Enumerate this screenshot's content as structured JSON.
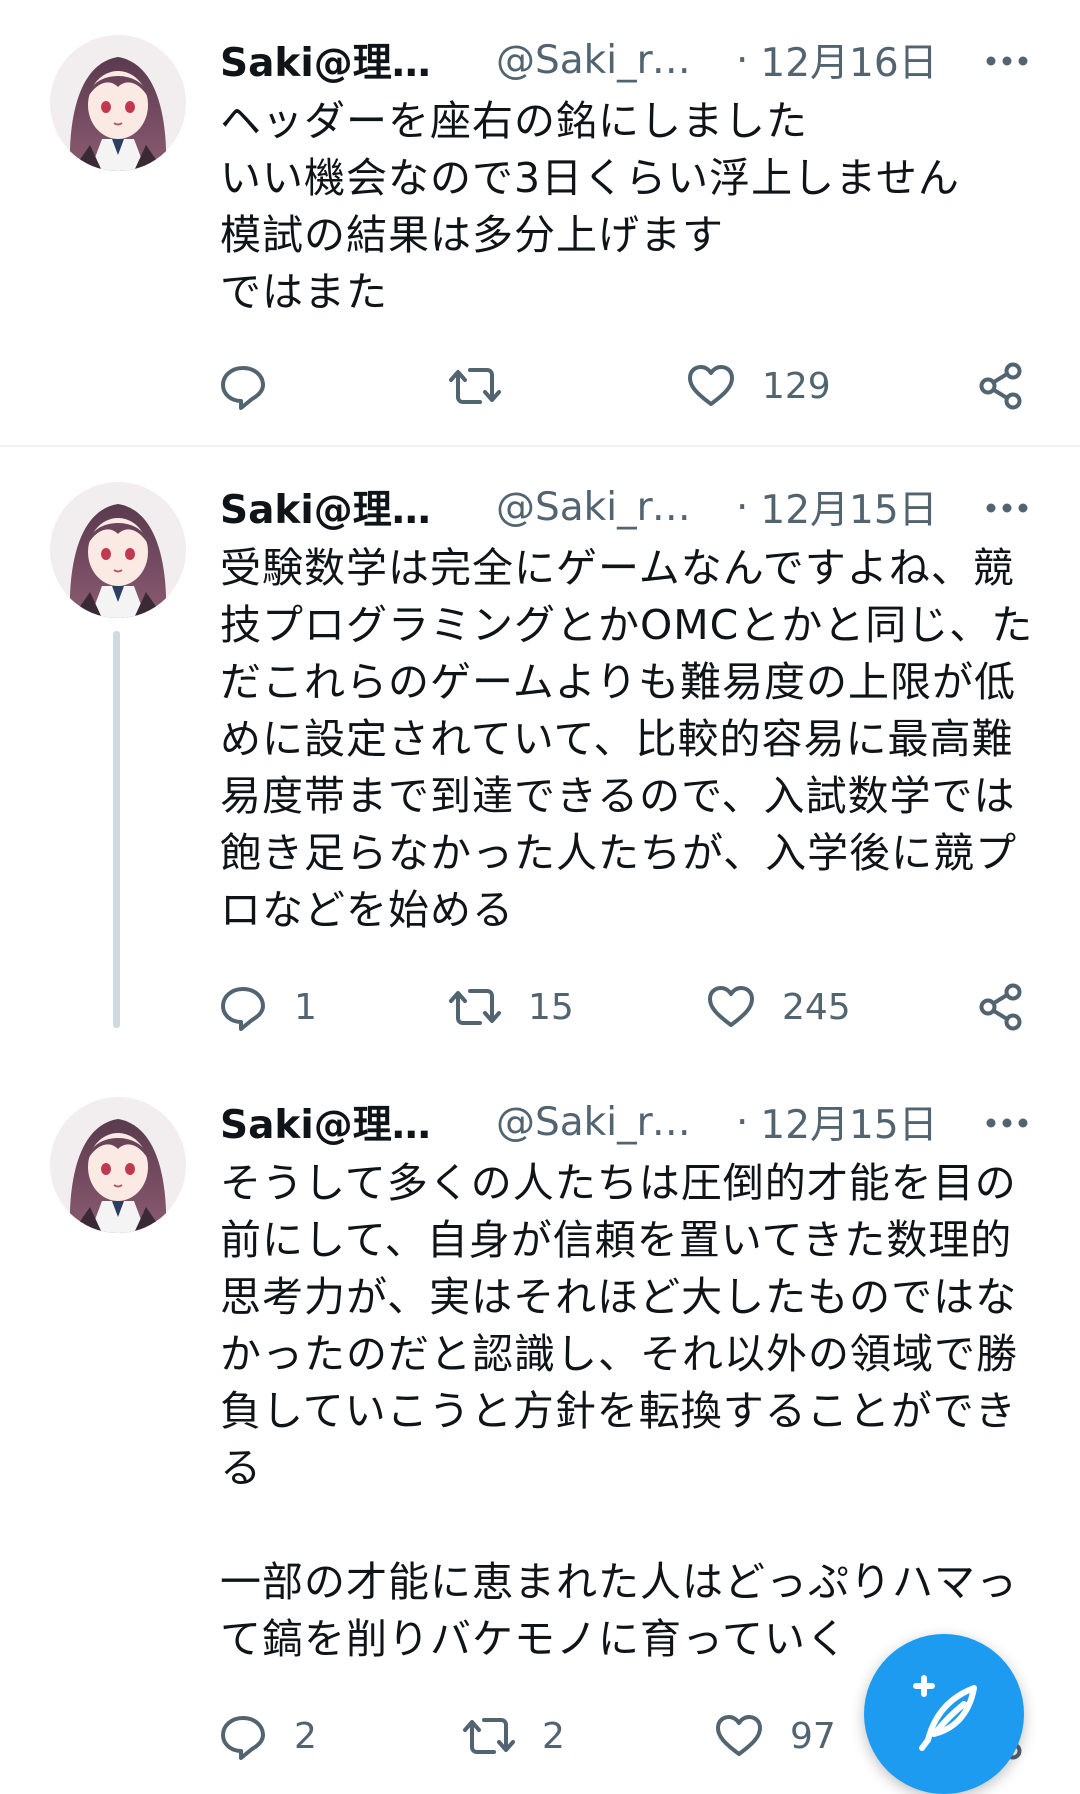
{
  "colors": {
    "accent": "#1d9bf0",
    "secondary_text": "#536471",
    "thread_line": "#cfd9de"
  },
  "tweets": [
    {
      "name": "Saki@理三...",
      "handle": "@Saki_re...",
      "separator": "·",
      "date": "12月16日",
      "text": "ヘッダーを座右の銘にしました\nいい機会なので3日くらい浮上しません\n模試の結果は多分上げます\nではまた",
      "reply_count": "",
      "retweet_count": "",
      "like_count": "129"
    },
    {
      "name": "Saki@理三...",
      "handle": "@Saki_re...",
      "separator": "·",
      "date": "12月15日",
      "text": "受験数学は完全にゲームなんですよね、競\n技プログラミングとかOMCとかと同じ、た\nだこれらのゲームよりも難易度の上限が低\nめに設定されていて、比較的容易に最高難\n易度帯まで到達できるので、入試数学では\n飽き足らなかった人たちが、入学後に競プ\nロなどを始める",
      "reply_count": "1",
      "retweet_count": "15",
      "like_count": "245"
    },
    {
      "name": "Saki@理三...",
      "handle": "@Saki_re...",
      "separator": "·",
      "date": "12月15日",
      "text": "そうして多くの人たちは圧倒的才能を目の\n前にして、自身が信頼を置いてきた数理的\n思考力が、実はそれほど大したものではな\nかったのだと認識し、それ以外の領域で勝\n負していこうと方針を転換することができ\nる\n\n一部の才能に恵まれた人はどっぷりハマっ\nて鎬を削りバケモノに育っていく",
      "reply_count": "2",
      "retweet_count": "2",
      "like_count": "97"
    }
  ],
  "icons": {
    "reply": "reply-icon",
    "retweet": "retweet-icon",
    "like": "like-icon",
    "share": "share-icon",
    "more": "more-icon",
    "compose": "compose-tweet-icon"
  }
}
